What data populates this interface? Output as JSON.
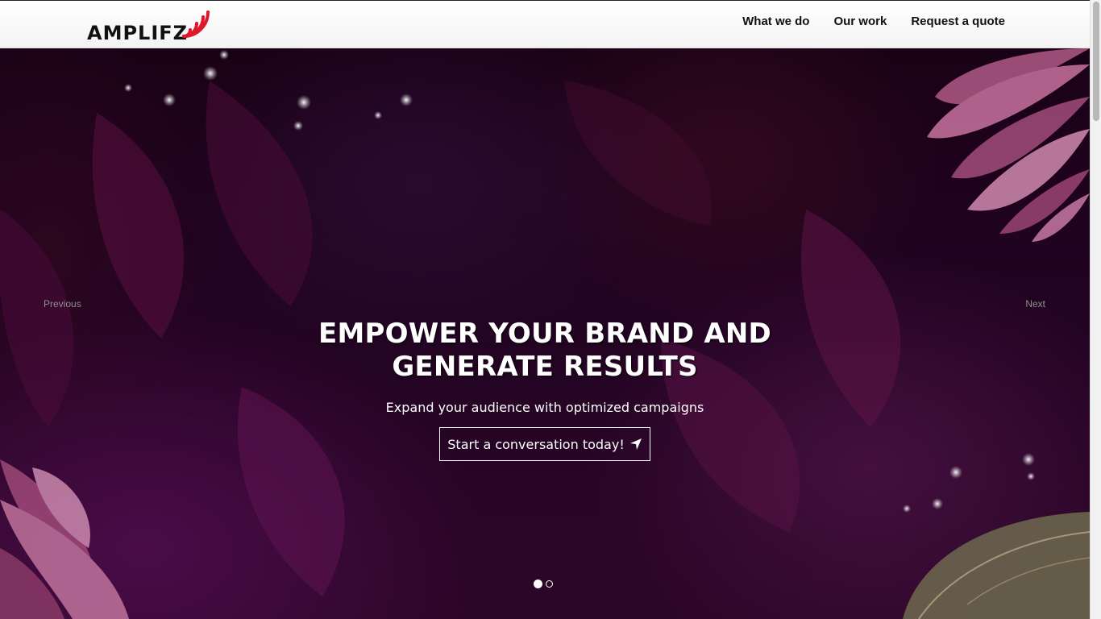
{
  "brand": {
    "name": "AMPLIFZ"
  },
  "nav": {
    "items": [
      {
        "label": "What we do"
      },
      {
        "label": "Our work"
      },
      {
        "label": "Request a quote"
      }
    ]
  },
  "hero": {
    "title": "EMPOWER YOUR BRAND AND GENERATE RESULTS",
    "subtitle": "Expand your audience with optimized campaigns",
    "cta_label": "Start a conversation today!",
    "cta_icon": "location-arrow-icon",
    "prev_label": "Previous",
    "next_label": "Next",
    "slide_count": 2,
    "active_slide": 1
  },
  "colors": {
    "logo_accent": "#e0162b",
    "hero_background": "#220322",
    "text_light": "#ffffff"
  }
}
